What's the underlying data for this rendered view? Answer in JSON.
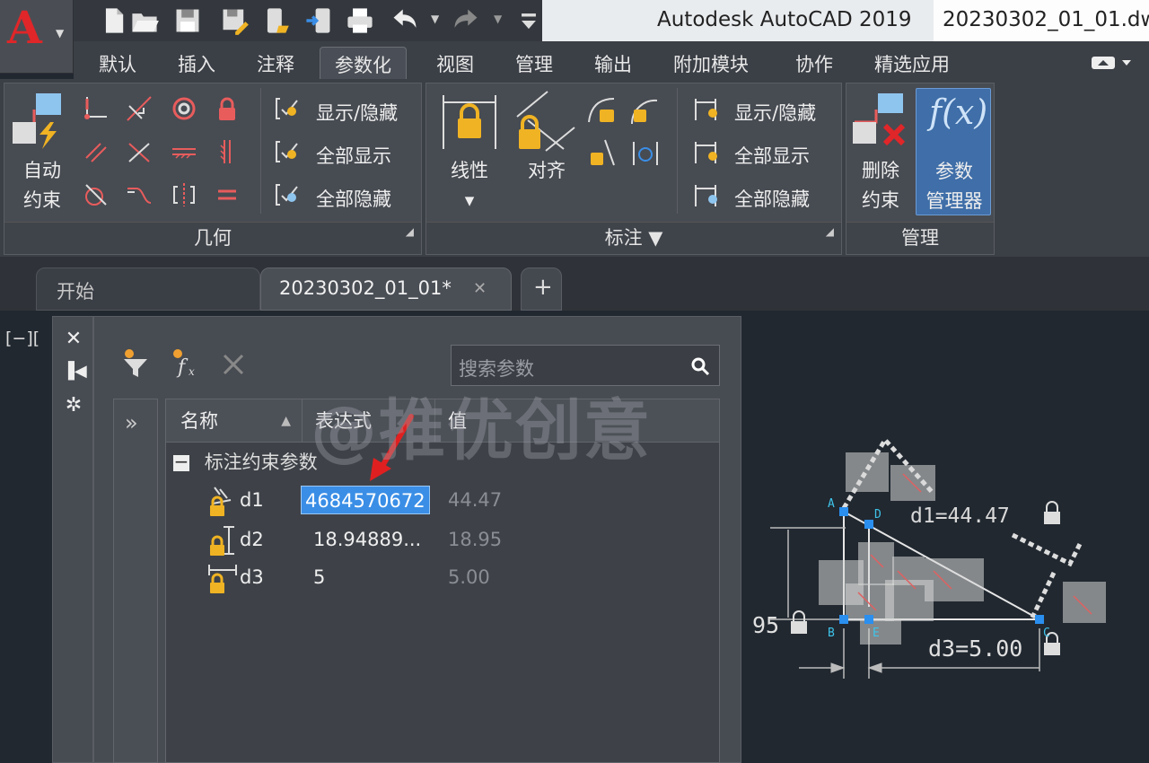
{
  "title_bar": {
    "app_logo_letter": "A",
    "app_name": "Autodesk AutoCAD 2019",
    "file_name": "20230302_01_01.dw"
  },
  "quick_access": [
    "new-icon",
    "open-icon",
    "save-icon",
    "save-as-icon",
    "open-from-web-icon",
    "save-to-web-icon",
    "plot-icon",
    "undo-icon",
    "redo-icon",
    "customize-icon"
  ],
  "ribbon_tabs": [
    "默认",
    "插入",
    "注释",
    "参数化",
    "视图",
    "管理",
    "输出",
    "附加模块",
    "协作",
    "精选应用"
  ],
  "active_tab": "参数化",
  "ribbon": {
    "geometric": {
      "title": "几何",
      "auto_constrain_label": "自动\n约束",
      "show_hide": "显示/隐藏",
      "show_all": "全部显示",
      "hide_all": "全部隐藏"
    },
    "dimensional": {
      "title": "标注",
      "linear": "线性",
      "aligned": "对齐",
      "show_hide": "显示/隐藏",
      "show_all": "全部显示",
      "hide_all": "全部隐藏"
    },
    "manage": {
      "title": "管理",
      "delete_constraints": "删除\n约束",
      "param_manager": "参数\n管理器",
      "fx_glyph": "f(x)"
    }
  },
  "file_tabs": {
    "start": "开始",
    "current": "20230302_01_01*",
    "add": "+"
  },
  "viewport_label": "[−][",
  "param_manager": {
    "search_placeholder": "搜索参数",
    "expand_glyph": "»",
    "columns": [
      "名称",
      "表达式",
      "值"
    ],
    "group_toggle": "−",
    "group_label": "标注约束参数",
    "rows": [
      {
        "name": "d1",
        "expression": "4684570672",
        "value": "44.47",
        "editing": true
      },
      {
        "name": "d2",
        "expression": "18.94889...",
        "value": "18.95",
        "editing": false
      },
      {
        "name": "d3",
        "expression": "5",
        "value": "5.00",
        "editing": false
      }
    ]
  },
  "watermark": "@推优创意",
  "drawing": {
    "points": [
      "A",
      "D",
      "B",
      "E",
      "C"
    ],
    "dim_d1": "d1=44.47",
    "dim_95": "95",
    "dim_d3": "d3=5.00"
  },
  "colors": {
    "accent_blue": "#3a8ee6",
    "selection_blue": "#3f87d8",
    "lock_yellow": "#f0b323",
    "logo_red": "#e02629",
    "arrow_red": "#e02020"
  }
}
